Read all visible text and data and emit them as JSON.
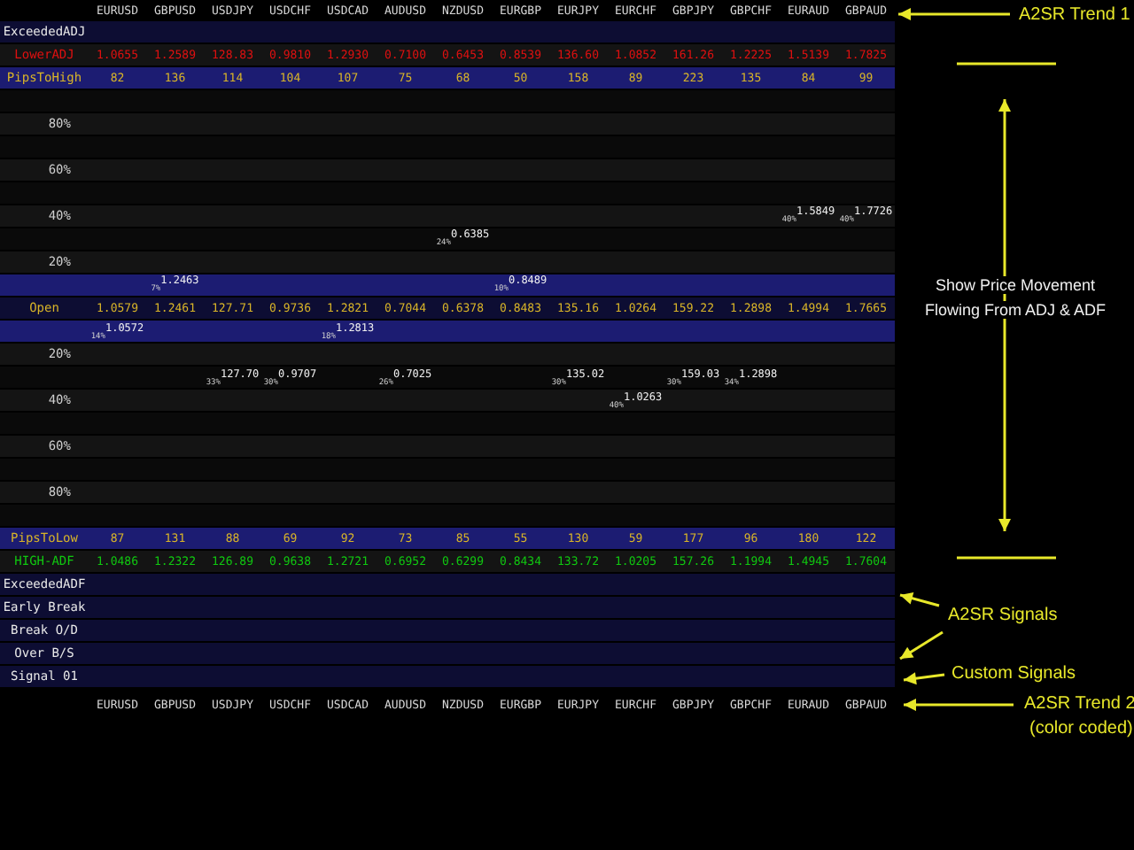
{
  "symbols_top": [
    "EURUSD",
    "GBPUSD",
    "USDJPY",
    "USDCHF",
    "USDCAD",
    "AUDUSD",
    "NZDUSD",
    "EURGBP",
    "EURJPY",
    "EURCHF",
    "GBPJPY",
    "GBPCHF",
    "EURAUD",
    "GBPAUD"
  ],
  "rows": [
    {
      "kind": "signal",
      "label": "ExceededADJ"
    },
    {
      "kind": "price",
      "label": "LowerADJ",
      "color": "#e01010",
      "values": [
        "1.0655",
        "1.2589",
        "128.83",
        "0.9810",
        "1.2930",
        "0.7100",
        "0.6453",
        "0.8539",
        "136.60",
        "1.0852",
        "161.26",
        "1.2225",
        "1.5139",
        "1.7825"
      ]
    },
    {
      "kind": "pips",
      "label": "PipsToHigh",
      "color": "#d8b428",
      "values": [
        "82",
        "136",
        "114",
        "104",
        "107",
        "75",
        "68",
        "50",
        "158",
        "89",
        "223",
        "135",
        "84",
        "99"
      ]
    },
    {
      "kind": "gap"
    },
    {
      "kind": "level",
      "label": "80%"
    },
    {
      "kind": "gap"
    },
    {
      "kind": "level",
      "label": "60%"
    },
    {
      "kind": "gap"
    },
    {
      "kind": "level",
      "label": "40%"
    },
    {
      "kind": "gap"
    },
    {
      "kind": "level",
      "label": "20%"
    },
    {
      "kind": "band"
    },
    {
      "kind": "open",
      "label": "Open",
      "color": "#d8b428",
      "values": [
        "1.0579",
        "1.2461",
        "127.71",
        "0.9736",
        "1.2821",
        "0.7044",
        "0.6378",
        "0.8483",
        "135.16",
        "1.0264",
        "159.22",
        "1.2898",
        "1.4994",
        "1.7665"
      ]
    },
    {
      "kind": "band"
    },
    {
      "kind": "level",
      "label": "20%"
    },
    {
      "kind": "gap"
    },
    {
      "kind": "level",
      "label": "40%"
    },
    {
      "kind": "gap"
    },
    {
      "kind": "level",
      "label": "60%"
    },
    {
      "kind": "gap"
    },
    {
      "kind": "level",
      "label": "80%"
    },
    {
      "kind": "gap"
    },
    {
      "kind": "pips",
      "label": "PipsToLow",
      "color": "#d8b428",
      "values": [
        "87",
        "131",
        "88",
        "69",
        "92",
        "73",
        "85",
        "55",
        "130",
        "59",
        "177",
        "96",
        "180",
        "122"
      ]
    },
    {
      "kind": "price",
      "label": "HIGH-ADF",
      "color": "#10c810",
      "values": [
        "1.0486",
        "1.2322",
        "126.89",
        "0.9638",
        "1.2721",
        "0.6952",
        "0.6299",
        "0.8434",
        "133.72",
        "1.0205",
        "157.26",
        "1.1994",
        "1.4945",
        "1.7604"
      ]
    },
    {
      "kind": "signal",
      "label": "ExceededADF"
    },
    {
      "kind": "signal",
      "label": "Early Break"
    },
    {
      "kind": "signal",
      "label": "Break O/D"
    },
    {
      "kind": "signal",
      "label": "Over B/S"
    },
    {
      "kind": "signal",
      "label": "Signal 01"
    }
  ],
  "price_markers": [
    {
      "above_open": false,
      "percent": "14%",
      "value": "1.0572"
    },
    {
      "above_open": true,
      "percent": "7%",
      "value": "1.2463"
    },
    {
      "above_open": false,
      "percent": "33%",
      "value": "127.70"
    },
    {
      "above_open": false,
      "percent": "30%",
      "value": "0.9707"
    },
    {
      "above_open": false,
      "percent": "18%",
      "value": "1.2813"
    },
    {
      "above_open": false,
      "percent": "26%",
      "value": "0.7025"
    },
    {
      "above_open": true,
      "percent": "24%",
      "value": "0.6385"
    },
    {
      "above_open": true,
      "percent": "10%",
      "value": "0.8489"
    },
    {
      "above_open": false,
      "percent": "30%",
      "value": "135.02"
    },
    {
      "above_open": false,
      "percent": "40%",
      "value": "1.0263"
    },
    {
      "above_open": false,
      "percent": "30%",
      "value": "159.03"
    },
    {
      "above_open": false,
      "percent": "34%",
      "value": "1.2898"
    },
    {
      "above_open": true,
      "percent": "40%",
      "value": "1.5849"
    },
    {
      "above_open": true,
      "percent": "40%",
      "value": "1.7726"
    }
  ],
  "symbols_bottom": [
    "EURUSD",
    "GBPUSD",
    "USDJPY",
    "USDCHF",
    "USDCAD",
    "AUDUSD",
    "NZDUSD",
    "EURGBP",
    "EURJPY",
    "EURCHF",
    "GBPJPY",
    "GBPCHF",
    "EURAUD",
    "GBPAUD"
  ],
  "annotations": {
    "trend1": "A2SR Trend 1",
    "price_flow": [
      "Show Price Movement",
      "Flowing From ADJ & ADF"
    ],
    "signals": "A2SR Signals",
    "custom_signals": "Custom Signals",
    "trend2": [
      "A2SR Trend 2",
      "(color coded)"
    ]
  }
}
